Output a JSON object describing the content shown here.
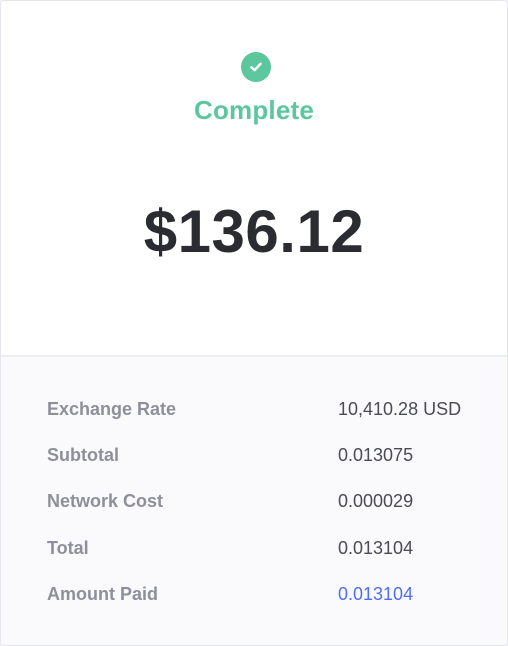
{
  "status": {
    "icon": "check-circle-icon",
    "label": "Complete",
    "color": "#5cc79c"
  },
  "amount": "$136.12",
  "details": [
    {
      "label": "Exchange Rate",
      "value": "10,410.28 USD"
    },
    {
      "label": "Subtotal",
      "value": "0.013075"
    },
    {
      "label": "Network Cost",
      "value": "0.000029"
    },
    {
      "label": "Total",
      "value": "0.013104"
    },
    {
      "label": "Amount Paid",
      "value": "0.013104",
      "link_color": "#4f6ef2"
    }
  ]
}
